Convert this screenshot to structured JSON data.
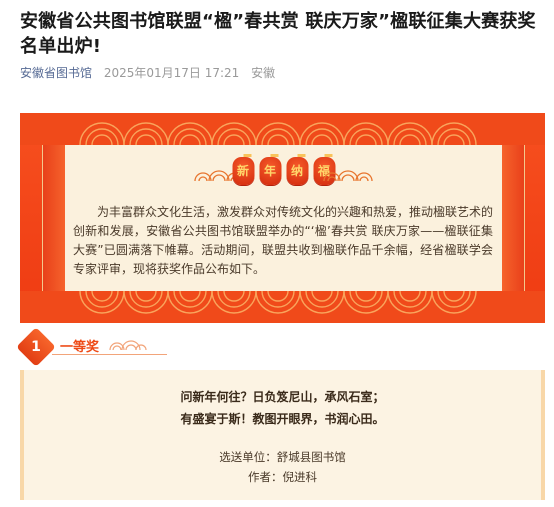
{
  "article": {
    "title": "安徽省公共图书馆联盟“楹”春共赏 联庆万家”楹联征集大赛获奖名单出炉!",
    "account": "安徽省图书馆",
    "datetime": "2025年01月17日 17:21",
    "location": "安徽"
  },
  "banner": {
    "heading_chars": [
      "新",
      "年",
      "纳",
      "福"
    ],
    "notice": "为丰富群众文化生活，激发群众对传统文化的兴趣和热爱，推动楹联艺术的创新和发展，安徽省公共图书馆联盟举办的“‘楹’春共赏  联庆万家——楹联征集大赛”已圆满落下帷幕。活动期间，联盟共收到楹联作品千余幅，经省楹联学会专家评审，现将获奖作品公布如下。"
  },
  "award": {
    "number": "1",
    "label": "一等奖",
    "line1": "问新年何往？日负笈尼山，承风石室；",
    "line2": "有盛宴于斯！教图开眼界，书润心田。",
    "unit": "选送单位：舒城县图书馆",
    "author": "作者：倪进科"
  },
  "colors": {
    "accent": "#ee4a16",
    "link": "#576b95",
    "cream": "#fbf1dd"
  }
}
